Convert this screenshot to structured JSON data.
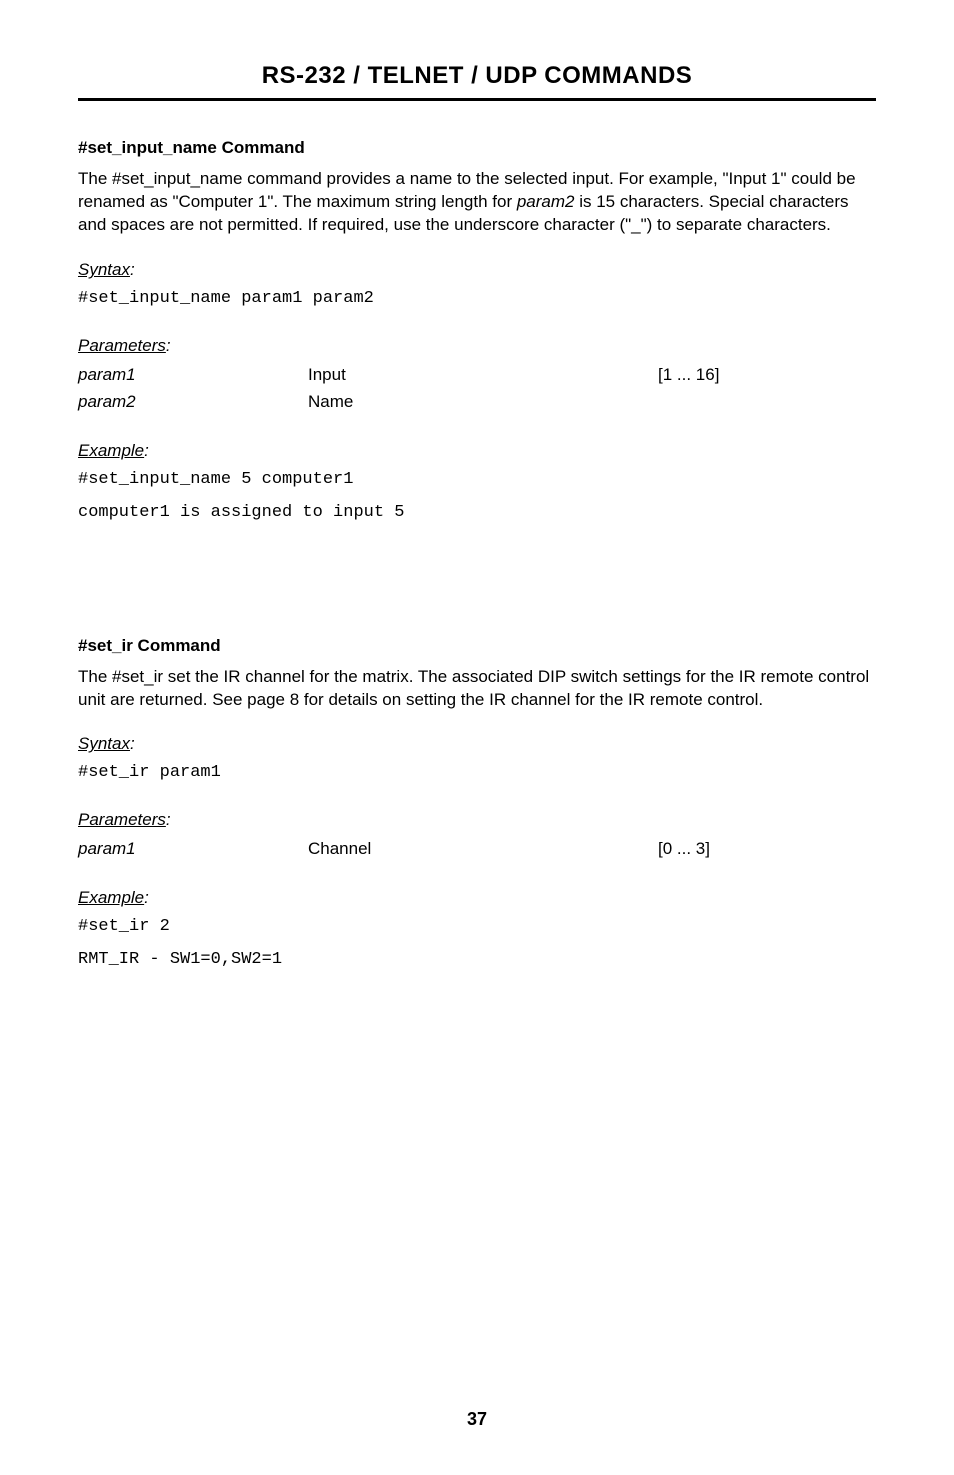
{
  "header": {
    "title": "RS-232 / TELNET / UDP COMMANDS"
  },
  "cmd1": {
    "heading": "#set_input_name Command",
    "description_pre": "The #set_input_name command provides a name to the selected input.  For example, \"Input 1\" could be renamed as \"Computer 1\".  The maximum string length for ",
    "description_param": "param2",
    "description_post": " is 15 characters.  Special characters and spaces are not permitted.  If required, use the underscore character (\"_\") to separate characters.",
    "syntax_label": "Syntax",
    "syntax_code": "#set_input_name param1 param2",
    "params_label": "Parameters",
    "params": [
      {
        "name": "param1",
        "desc": "Input",
        "range": "[1 ... 16]"
      },
      {
        "name": "param2",
        "desc": "Name",
        "range": ""
      }
    ],
    "example_label": "Example",
    "example_lines": [
      "#set_input_name 5 computer1",
      "computer1 is assigned to input 5"
    ]
  },
  "cmd2": {
    "heading": "#set_ir Command",
    "description": "The #set_ir set the IR channel for the matrix.  The associated DIP switch settings for the IR remote control unit are returned.  See page 8 for details on setting the IR channel for the IR remote control.",
    "syntax_label": "Syntax",
    "syntax_code": "#set_ir param1",
    "params_label": "Parameters",
    "params": [
      {
        "name": "param1",
        "desc": "Channel",
        "range": "[0 ... 3]"
      }
    ],
    "example_label": "Example",
    "example_lines": [
      "#set_ir 2",
      "RMT_IR - SW1=0,SW2=1"
    ]
  },
  "footer": {
    "page": "37"
  }
}
